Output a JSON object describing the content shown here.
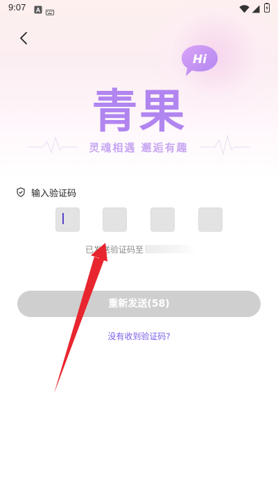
{
  "status_bar": {
    "time": "9:07",
    "left_icons": [
      "a-badge-icon",
      "keyboard-icon"
    ],
    "right_icons": [
      "wifi-icon",
      "signal-icon",
      "battery-icon"
    ]
  },
  "header": {
    "back_icon": "chevron-left-icon"
  },
  "logo": {
    "bubble_text": "Hi",
    "title": "青果",
    "slogan": "灵魂相遇 邂逅有趣",
    "title_color": "#b185f0",
    "slogan_color": "#c8a7f2"
  },
  "verify": {
    "label": "输入验证码",
    "code_boxes": [
      "",
      "",
      "",
      ""
    ],
    "sent_text": "已发送验证码至"
  },
  "resend_button": {
    "label": "重新发送(58)"
  },
  "no_code_link": {
    "label": "没有收到验证码?"
  },
  "colors": {
    "accent": "#7a5ce6",
    "button_disabled": "#cfcfcf",
    "annotation_arrow": "#e8262f"
  }
}
